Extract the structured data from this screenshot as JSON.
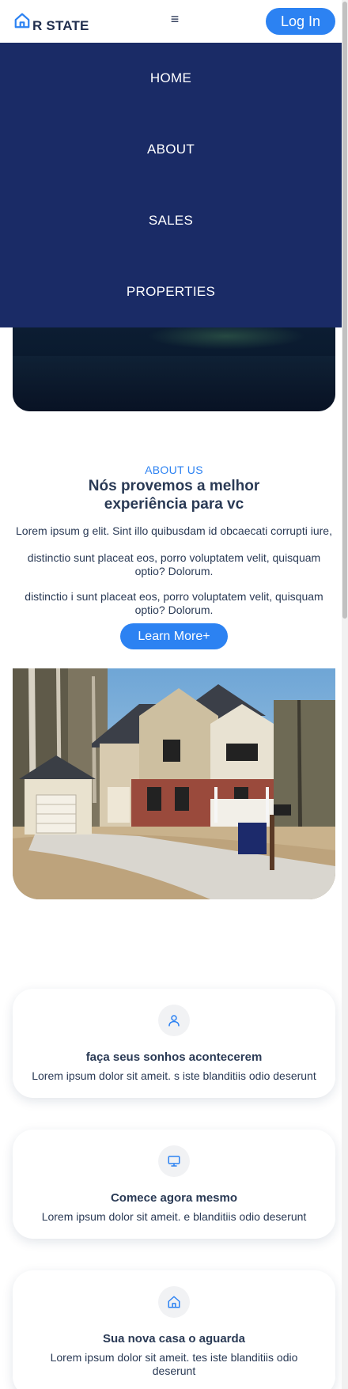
{
  "header": {
    "logo_text": "R STATE",
    "menu_icon": "hamburger-icon",
    "login_label": "Log In"
  },
  "nav": {
    "items": [
      {
        "label": "HOME"
      },
      {
        "label": "ABOUT"
      },
      {
        "label": "SALES"
      },
      {
        "label": "PROPERTIES"
      }
    ]
  },
  "about": {
    "tag": "ABOUT US",
    "title": "Nós provemos a melhor experiência para vc",
    "paragraphs": [
      "Lorem ipsum g elit. Sint illo quibusdam id obcaecati corrupti iure,",
      "distinctio sunt placeat eos, porro voluptatem velit, quisquam optio? Dolorum.",
      "distinctio i sunt placeat eos, porro voluptatem velit, quisquam optio? Dolorum."
    ],
    "button_label": "Learn More+"
  },
  "features": [
    {
      "icon": "user-icon",
      "title": "faça seus sonhos acontecerem",
      "text": "Lorem ipsum dolor sit ameit. s iste blanditiis odio deserunt"
    },
    {
      "icon": "monitor-icon",
      "title": "Comece agora mesmo",
      "text": "Lorem ipsum dolor sit ameit. e blanditiis odio deserunt"
    },
    {
      "icon": "house-icon",
      "title": "Sua nova casa o aguarda",
      "text": "Lorem ipsum dolor sit ameit. tes iste blanditiis odio deserunt"
    }
  ],
  "colors": {
    "accent": "#2c82f2",
    "nav_bg": "#1a2b66",
    "text": "#2a3a55"
  }
}
